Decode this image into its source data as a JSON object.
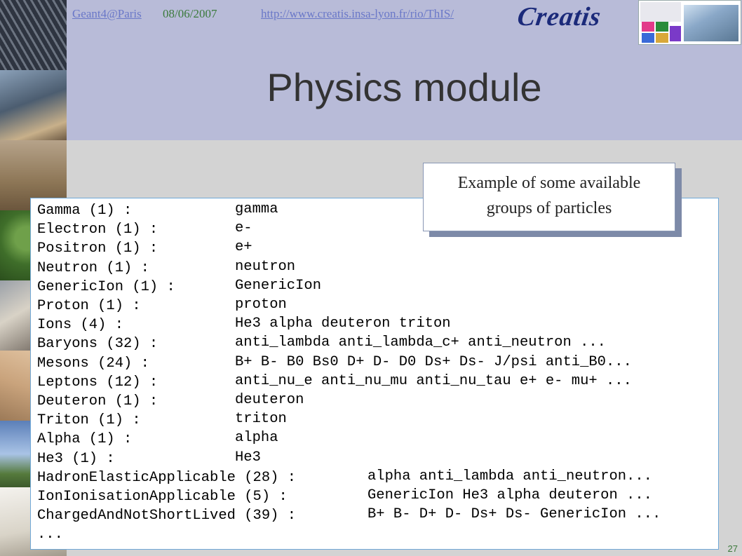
{
  "header": {
    "link_left": "Geant4@Paris",
    "date": "08/06/2007",
    "link_url": "http://www.creatis.insa-lyon.fr/rio/ThIS/",
    "logo_text": "Creatis"
  },
  "slide": {
    "title": "Physics module",
    "callout_line1": "Example of some available",
    "callout_line2": "groups of particles",
    "page_number": "27"
  },
  "particle_groups": [
    {
      "name": "Gamma (1) :",
      "particles": "gamma"
    },
    {
      "name": "Electron (1) :",
      "particles": "e-"
    },
    {
      "name": "Positron (1) :",
      "particles": "e+"
    },
    {
      "name": "Neutron (1) :",
      "particles": "neutron"
    },
    {
      "name": "GenericIon (1) :",
      "particles": "GenericIon"
    },
    {
      "name": "Proton (1) :",
      "particles": "proton"
    },
    {
      "name": "Ions (4) :",
      "particles": "He3 alpha deuteron triton"
    },
    {
      "name": "Baryons (32) :",
      "particles": "anti_lambda anti_lambda_c+ anti_neutron ..."
    },
    {
      "name": "Mesons (24) :",
      "particles": "B+ B- B0 Bs0 D+ D- D0 Ds+ Ds- J/psi anti_B0..."
    },
    {
      "name": "Leptons (12) :",
      "particles": "anti_nu_e anti_nu_mu anti_nu_tau e+ e- mu+ ..."
    },
    {
      "name": "Deuteron (1) :",
      "particles": "deuteron"
    },
    {
      "name": "Triton (1) :",
      "particles": "triton"
    },
    {
      "name": "Alpha (1) :",
      "particles": "alpha"
    },
    {
      "name": "He3 (1) :",
      "particles": "He3"
    },
    {
      "name": "HadronElasticApplicable (28) :",
      "particles": "alpha anti_lambda anti_neutron..."
    },
    {
      "name": "IonIonisationApplicable (5) :",
      "particles": "GenericIon He3 alpha deuteron ..."
    },
    {
      "name": "ChargedAndNotShortLived (39) :",
      "particles": "B+ B- D+ D- Ds+ Ds- GenericIon ..."
    },
    {
      "name": "...",
      "particles": ""
    }
  ]
}
